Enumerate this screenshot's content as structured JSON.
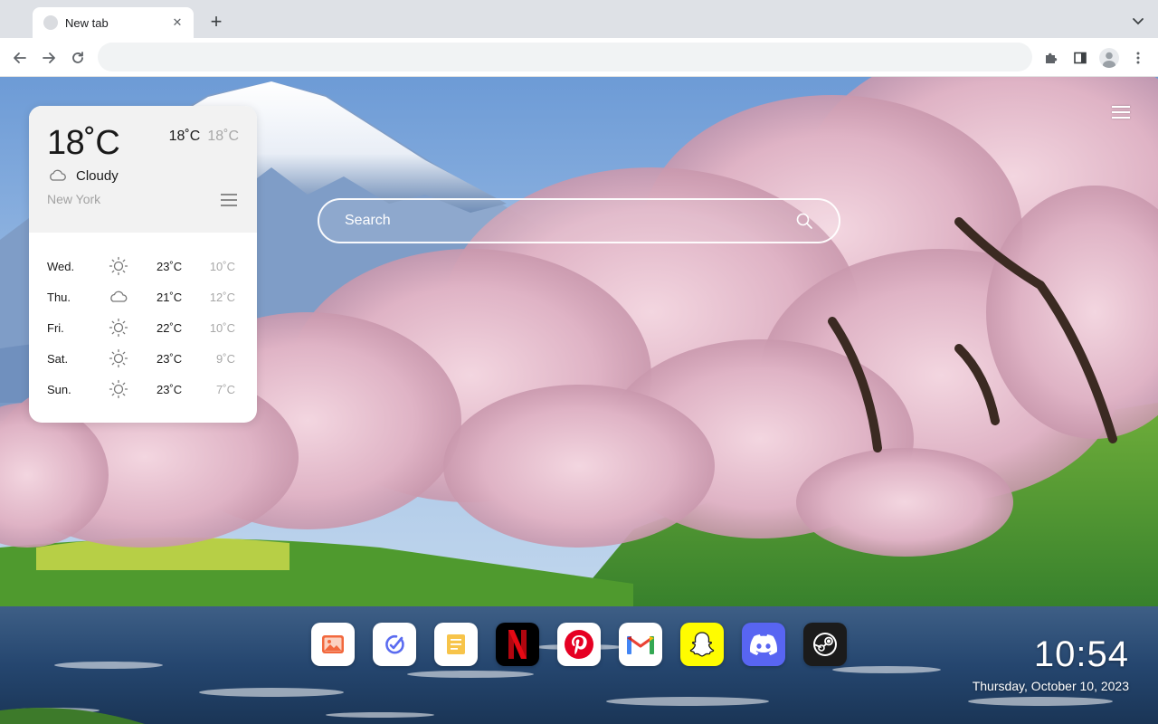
{
  "browser": {
    "tab_title": "New tab",
    "new_tab": "+",
    "close": "✕",
    "address_placeholder": ""
  },
  "weather": {
    "current_temp": "18˚C",
    "high": "18˚C",
    "low": "18˚C",
    "condition": "Cloudy",
    "city": "New York",
    "forecast": [
      {
        "day": "Wed.",
        "icon": "sun-icon",
        "high": "23˚C",
        "low": "10˚C"
      },
      {
        "day": "Thu.",
        "icon": "cloud-icon",
        "high": "21˚C",
        "low": "12˚C"
      },
      {
        "day": "Fri.",
        "icon": "sun-icon",
        "high": "22˚C",
        "low": "10˚C"
      },
      {
        "day": "Sat.",
        "icon": "sun-icon",
        "high": "23˚C",
        "low": "9˚C"
      },
      {
        "day": "Sun.",
        "icon": "sun-icon",
        "high": "23˚C",
        "low": "7˚C"
      }
    ]
  },
  "search": {
    "placeholder": "Search"
  },
  "dock": {
    "apps": [
      {
        "name": "photos",
        "icon": "photos-icon",
        "color": "#ffffff"
      },
      {
        "name": "tasks",
        "icon": "tasks-icon",
        "color": "#ffffff"
      },
      {
        "name": "notes",
        "icon": "notes-icon",
        "color": "#ffffff"
      },
      {
        "name": "netflix",
        "icon": "netflix-icon",
        "color": "#000000"
      },
      {
        "name": "pinterest",
        "icon": "pinterest-icon",
        "color": "#ffffff"
      },
      {
        "name": "gmail",
        "icon": "gmail-icon",
        "color": "#ffffff"
      },
      {
        "name": "snapchat",
        "icon": "snapchat-icon",
        "color": "#fffc00"
      },
      {
        "name": "discord",
        "icon": "discord-icon",
        "color": "#5865f2"
      },
      {
        "name": "steam",
        "icon": "steam-icon",
        "color": "#1b1b1b"
      }
    ]
  },
  "clock": {
    "time": "10:54",
    "date": "Thursday, October 10, 2023"
  }
}
